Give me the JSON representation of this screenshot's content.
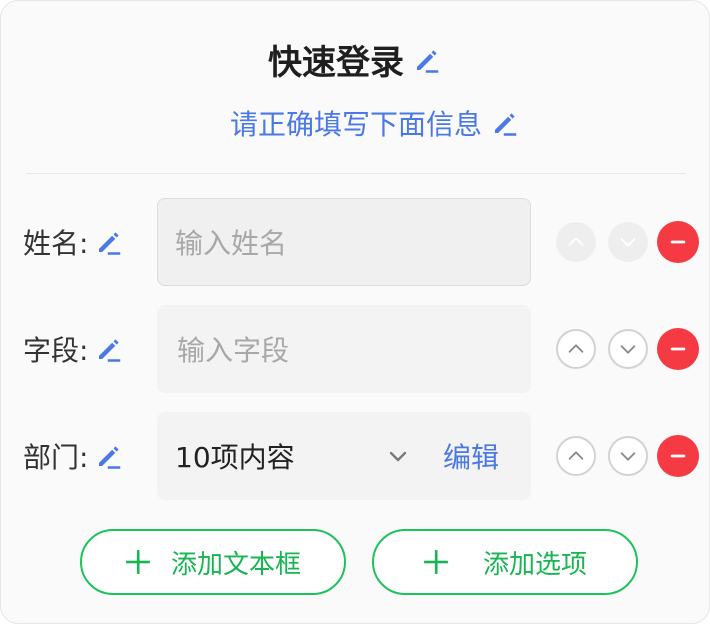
{
  "form": {
    "title": "快速登录",
    "subtitle": "请正确填写下面信息"
  },
  "fields": [
    {
      "label": "姓名:",
      "placeholder": "输入姓名",
      "up_enabled": false,
      "down_enabled": false
    },
    {
      "label": "字段:",
      "placeholder": "输入字段",
      "up_enabled": true,
      "down_enabled": true
    },
    {
      "label": "部门:",
      "value": "10项内容",
      "edit_label": "编辑",
      "up_enabled": true,
      "down_enabled": true
    }
  ],
  "actions": {
    "add_text_box": "添加文本框",
    "add_option": "添加选项"
  },
  "icons": {
    "edit": "pencil-icon",
    "move_up": "chevron-up-icon",
    "move_down": "chevron-down-icon",
    "remove": "minus-circle-icon",
    "add": "plus-icon",
    "dropdown": "chevron-down-icon"
  },
  "colors": {
    "accent_blue": "#4a78e6",
    "danger_red": "#f53a44",
    "success_green": "#1ec25a"
  }
}
